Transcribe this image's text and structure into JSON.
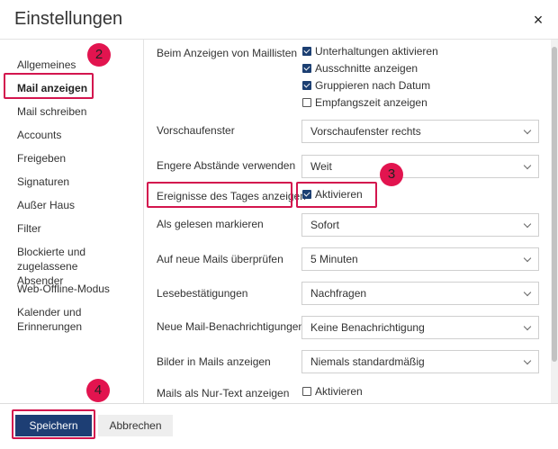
{
  "dialog": {
    "title": "Einstellungen",
    "close_symbol": "×"
  },
  "sidebar": {
    "items": [
      {
        "label": "Allgemeines"
      },
      {
        "label": "Mail anzeigen",
        "active": true
      },
      {
        "label": "Mail schreiben"
      },
      {
        "label": "Accounts"
      },
      {
        "label": "Freigeben"
      },
      {
        "label": "Signaturen"
      },
      {
        "label": "Außer Haus"
      },
      {
        "label": "Filter"
      },
      {
        "label": "Blockierte und zugelassene Absender"
      },
      {
        "label": "Web-Offline-Modus"
      },
      {
        "label": "Kalender und Erinnerungen"
      }
    ]
  },
  "settings": {
    "maillisten": {
      "label": "Beim Anzeigen von Maillisten",
      "options": [
        {
          "label": "Unterhaltungen aktivieren",
          "checked": true
        },
        {
          "label": "Ausschnitte anzeigen",
          "checked": true
        },
        {
          "label": "Gruppieren nach Datum",
          "checked": true
        },
        {
          "label": "Empfangszeit anzeigen",
          "checked": false
        }
      ]
    },
    "vorschaufenster": {
      "label": "Vorschaufenster",
      "value": "Vorschaufenster rechts"
    },
    "abstaende": {
      "label": "Engere Abstände verwenden",
      "value": "Weit"
    },
    "ereignisse": {
      "label": "Ereignisse des Tages anzeigen",
      "option": "Aktivieren",
      "checked": true
    },
    "gelesen": {
      "label": "Als gelesen markieren",
      "value": "Sofort"
    },
    "neue_mails": {
      "label": "Auf neue Mails überprüfen",
      "value": "5 Minuten"
    },
    "lesebestaetigungen": {
      "label": "Lesebestätigungen",
      "value": "Nachfragen"
    },
    "benachrichtigungen": {
      "label": "Neue Mail-Benachrichtigungen",
      "value": "Keine Benachrichtigung"
    },
    "bilder": {
      "label": "Bilder in Mails anzeigen",
      "value": "Niemals standardmäßig"
    },
    "nur_text": {
      "label": "Mails als Nur-Text anzeigen",
      "option": "Aktivieren",
      "checked": false
    }
  },
  "footer": {
    "save_label": "Speichern",
    "cancel_label": "Abbrechen"
  },
  "annotations": {
    "badge_2": "2",
    "badge_3": "3",
    "badge_4": "4"
  },
  "colors": {
    "primary": "#1d3e74",
    "highlight": "#d3154e",
    "badge": "#e2144f"
  }
}
